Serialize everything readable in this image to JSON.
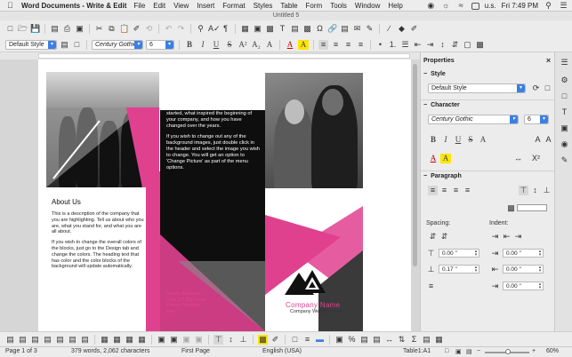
{
  "menubar": {
    "app_name": "Word Documents - Write & Edit",
    "items": [
      "File",
      "Edit",
      "View",
      "Insert",
      "Format",
      "Styles",
      "Table",
      "Form",
      "Tools",
      "Window",
      "Help"
    ],
    "locale": "u.s.",
    "clock": "Fri 7:49 PM"
  },
  "window": {
    "title": "Untitled 5"
  },
  "toolbar2": {
    "paragraph_style": "Default Style",
    "font_name": "Century Gothic",
    "font_size": "6"
  },
  "document": {
    "col2_paragraphs": [
      "started, what inspired the beginning of your company, and how you have changed over the years.",
      "If you wish to change out any of the background images, just double click in the header and select the image you wish to change.  You will get an option to 'Change Picture' as part of the menu options."
    ],
    "contact_lines": [
      "Street Address",
      "City, ST Zip Code",
      "Phone Number",
      "Fax"
    ],
    "about_title": "About Us",
    "about_paragraphs": [
      "This is a description of the company that you are highlighting.  Tell us about who you are, what you stand for, and what you are all about.",
      "If you wish to change the overall colors of the blocks, just go to the Design tab and change the colors.  The heading text that has color and the color blocks of the background will update automatically."
    ],
    "company_name": "Company Name",
    "company_website": "Company Website Here"
  },
  "sidebar": {
    "title": "Properties",
    "style_section": "Style",
    "style_value": "Default Style",
    "character_section": "Character",
    "char_font": "Century Gothic",
    "char_size": "6",
    "paragraph_section": "Paragraph",
    "spacing_label": "Spacing:",
    "indent_label": "Indent:",
    "spacing_above": "0.00 \"",
    "spacing_below": "0.17 \"",
    "indent_before": "0.00 \"",
    "indent_after": "0.00 \"",
    "indent_first": "0.00 \""
  },
  "status": {
    "page": "Page 1 of 3",
    "words": "379 words, 2,062 characters",
    "page_style": "First Page",
    "language": "English (USA)",
    "cell": "Table1:A1",
    "zoom": "60%"
  },
  "colors": {
    "accent_pink": "#e0418f",
    "dark": "#0e0e0e",
    "toolbar_blue": "#3b7fe4"
  }
}
